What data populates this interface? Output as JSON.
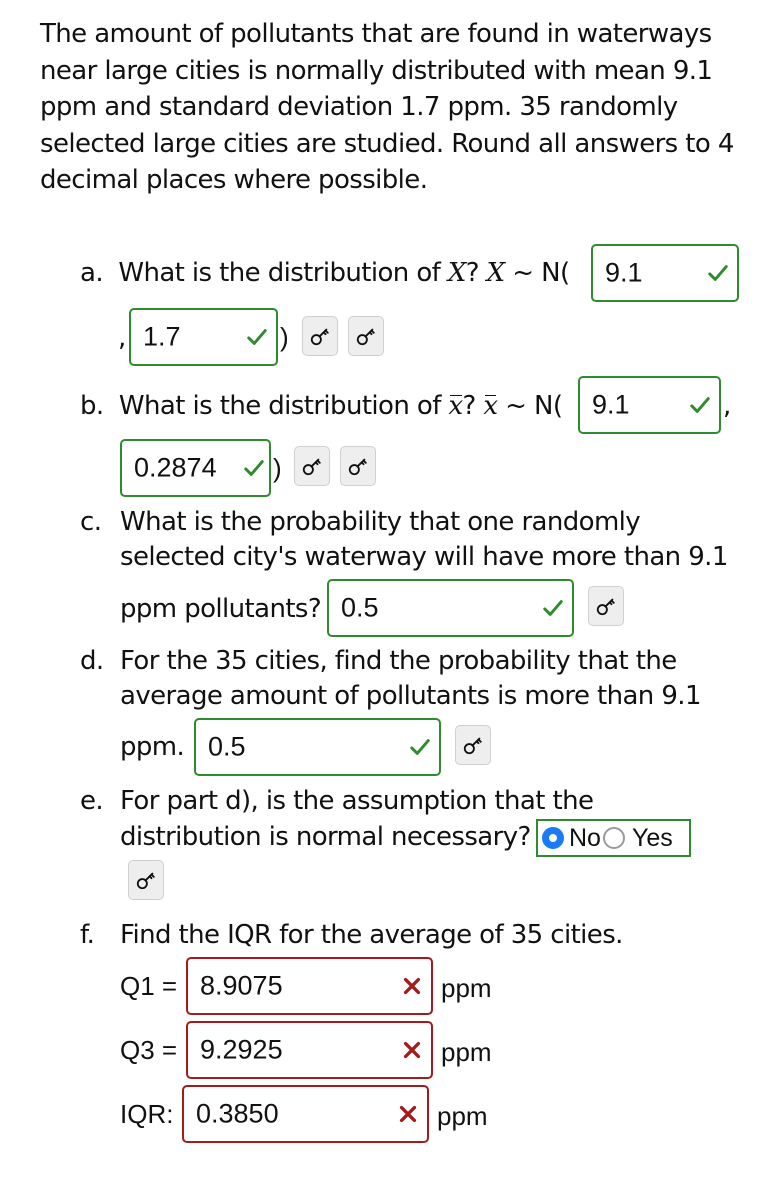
{
  "intro": "The amount of pollutants that are found in waterways near large cities is normally distributed with mean 9.1 ppm and standard deviation 1.7 ppm. 35 randomly selected large cities are studied. Round all answers to 4 decimal places where possible.",
  "parts": {
    "a": {
      "label": "a.",
      "text": "What is the distribution of",
      "var": "X",
      "qmark": "?",
      "tilde": "~ N(",
      "mean": "9.1",
      "comma": ",",
      "sd": "1.7",
      "close": ")",
      "mean_status": "correct",
      "sd_status": "correct"
    },
    "b": {
      "label": "b.",
      "text": "What is the distribution of",
      "var": "x",
      "qmark": "?",
      "tilde": "~ N(",
      "mean": "9.1",
      "comma": ",",
      "sd": "0.2874",
      "close": ")",
      "mean_status": "correct",
      "sd_status": "correct"
    },
    "c": {
      "label": "c.",
      "line1": "What is the probability that one randomly",
      "line2": "selected city's waterway will have more than 9.1",
      "line3": "ppm pollutants?",
      "answer": "0.5",
      "status": "correct"
    },
    "d": {
      "label": "d.",
      "line1": "For the 35 cities, find the probability that the",
      "line2": "average amount of pollutants is more than 9.1",
      "line3": "ppm.",
      "answer": "0.5",
      "status": "correct"
    },
    "e": {
      "label": "e.",
      "line1": "For part d), is the assumption that the",
      "line2": "distribution is normal necessary?",
      "options": [
        "No",
        "Yes"
      ],
      "selected": "No",
      "status": "correct"
    },
    "f": {
      "label": "f.",
      "text": "Find the IQR for the average of 35 cities.",
      "rows": [
        {
          "label": "Q1 =",
          "value": "8.9075",
          "unit": "ppm",
          "status": "incorrect"
        },
        {
          "label": "Q3 =",
          "value": "9.2925",
          "unit": "ppm",
          "status": "incorrect"
        },
        {
          "label": "IQR:",
          "value": "0.3850",
          "unit": "ppm",
          "status": "incorrect"
        }
      ]
    }
  },
  "icons": {
    "key": "key-icon",
    "check": "check-icon",
    "cross": "cross-icon"
  },
  "colors": {
    "correct": "#2e8b2e",
    "incorrect": "#a31b1b",
    "radio_selected": "#1a7cf5"
  }
}
